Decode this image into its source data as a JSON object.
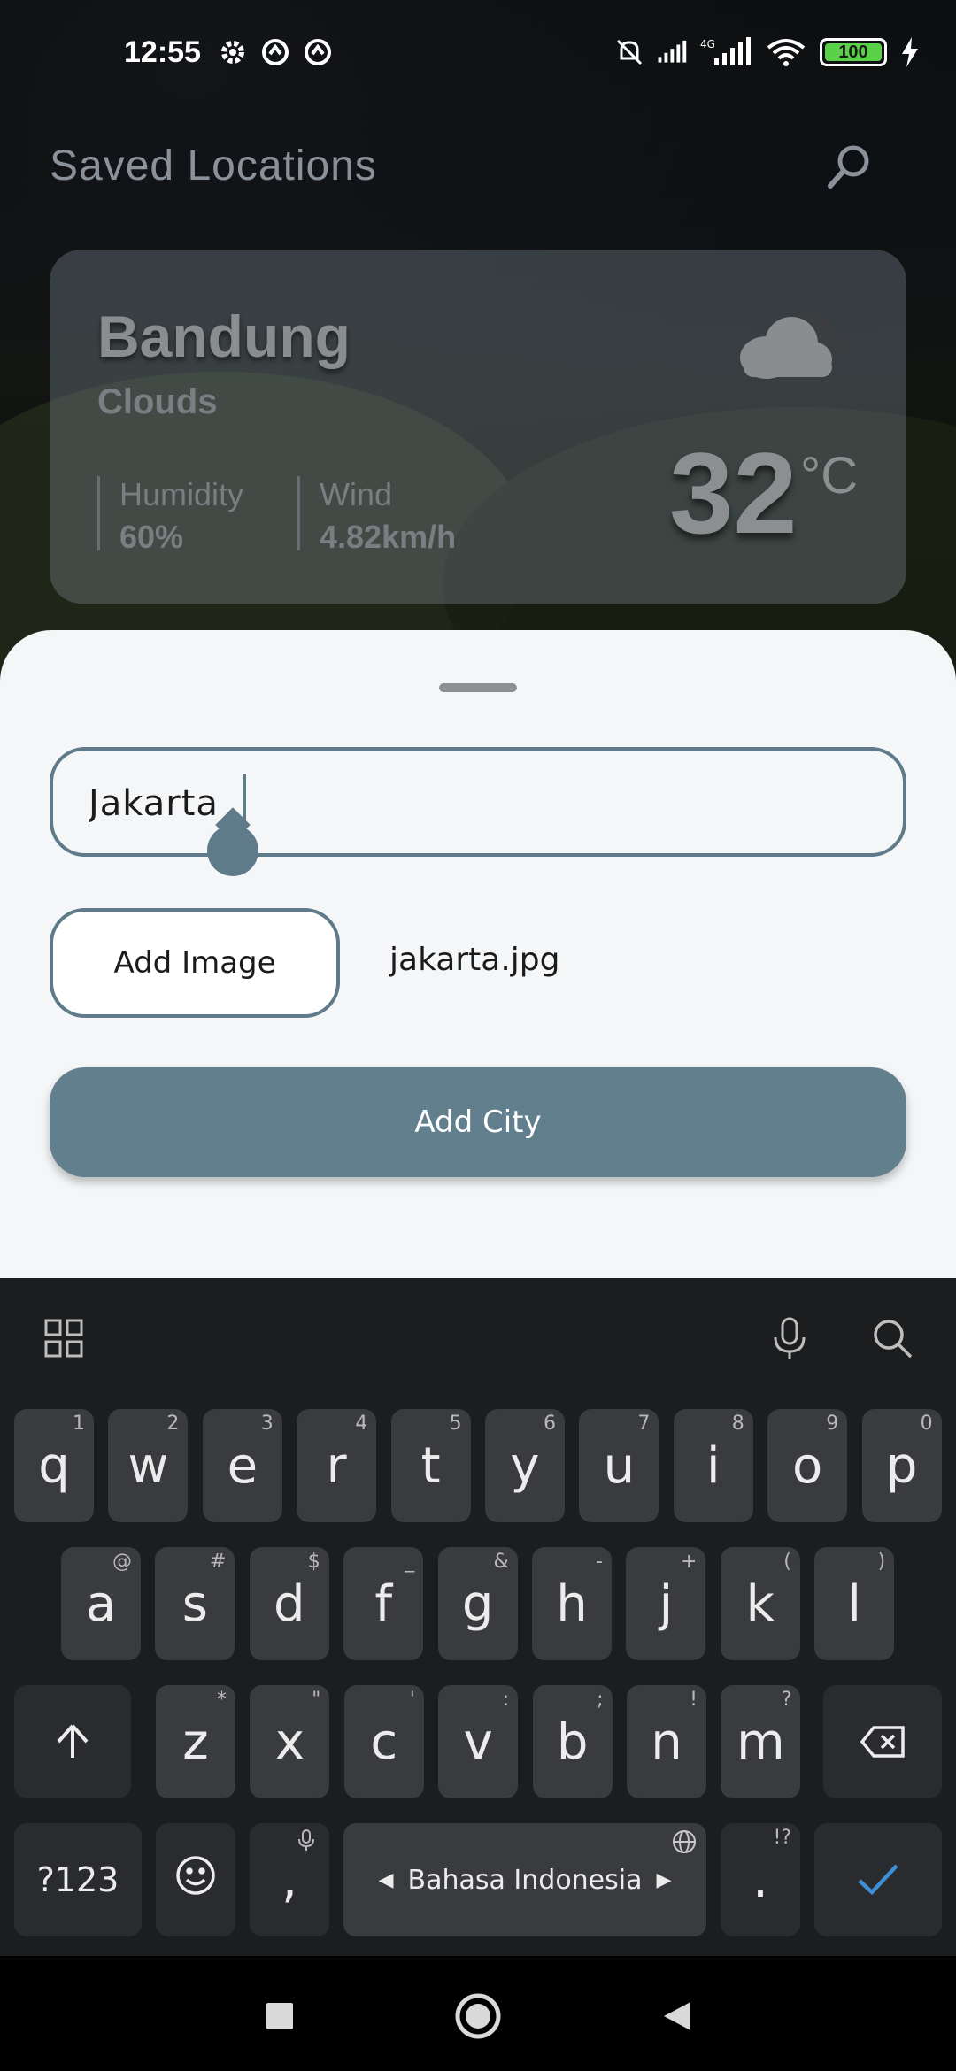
{
  "status_bar": {
    "time": "12:55",
    "battery": "100",
    "left_icons": [
      "gear-icon",
      "sync-icon",
      "sync-icon"
    ],
    "right_icons": [
      "mute-icon",
      "signal-icon",
      "signal-4g-icon",
      "wifi-icon",
      "battery-icon",
      "charging-icon"
    ]
  },
  "header": {
    "title": "Saved Locations",
    "search_icon": "search-icon"
  },
  "weather_card": {
    "city": "Bandung",
    "condition": "Clouds",
    "humidity_label": "Humidity",
    "humidity_value": "60%",
    "wind_label": "Wind",
    "wind_value": "4.82km/h",
    "temperature": "32",
    "unit": "°C",
    "icon": "cloud-icon"
  },
  "sheet": {
    "city_input_value": "Jakarta",
    "add_image_label": "Add Image",
    "file_name": "jakarta.jpg",
    "add_city_label": "Add City",
    "accent_color": "#627f8e"
  },
  "keyboard": {
    "row1": [
      {
        "k": "q",
        "h": "1"
      },
      {
        "k": "w",
        "h": "2"
      },
      {
        "k": "e",
        "h": "3"
      },
      {
        "k": "r",
        "h": "4"
      },
      {
        "k": "t",
        "h": "5"
      },
      {
        "k": "y",
        "h": "6"
      },
      {
        "k": "u",
        "h": "7"
      },
      {
        "k": "i",
        "h": "8"
      },
      {
        "k": "o",
        "h": "9"
      },
      {
        "k": "p",
        "h": "0"
      }
    ],
    "row2": [
      {
        "k": "a",
        "h": "@"
      },
      {
        "k": "s",
        "h": "#"
      },
      {
        "k": "d",
        "h": "$"
      },
      {
        "k": "f",
        "h": "_"
      },
      {
        "k": "g",
        "h": "&"
      },
      {
        "k": "h",
        "h": "-"
      },
      {
        "k": "j",
        "h": "+"
      },
      {
        "k": "k",
        "h": "("
      },
      {
        "k": "l",
        "h": ")"
      }
    ],
    "row3": [
      {
        "k": "z",
        "h": "*"
      },
      {
        "k": "x",
        "h": "\""
      },
      {
        "k": "c",
        "h": "'"
      },
      {
        "k": "v",
        "h": ":"
      },
      {
        "k": "b",
        "h": ";"
      },
      {
        "k": "n",
        "h": "!"
      },
      {
        "k": "m",
        "h": "?"
      }
    ],
    "symbols_label": "?123",
    "comma_label": ",",
    "space_label": "Bahasa Indonesia",
    "period_label": ".",
    "period_hint": "!?",
    "done_color": "#3d8fd6"
  },
  "nav_bar": {
    "icons": [
      "square-icon",
      "home-circle-icon",
      "back-triangle-icon"
    ]
  }
}
